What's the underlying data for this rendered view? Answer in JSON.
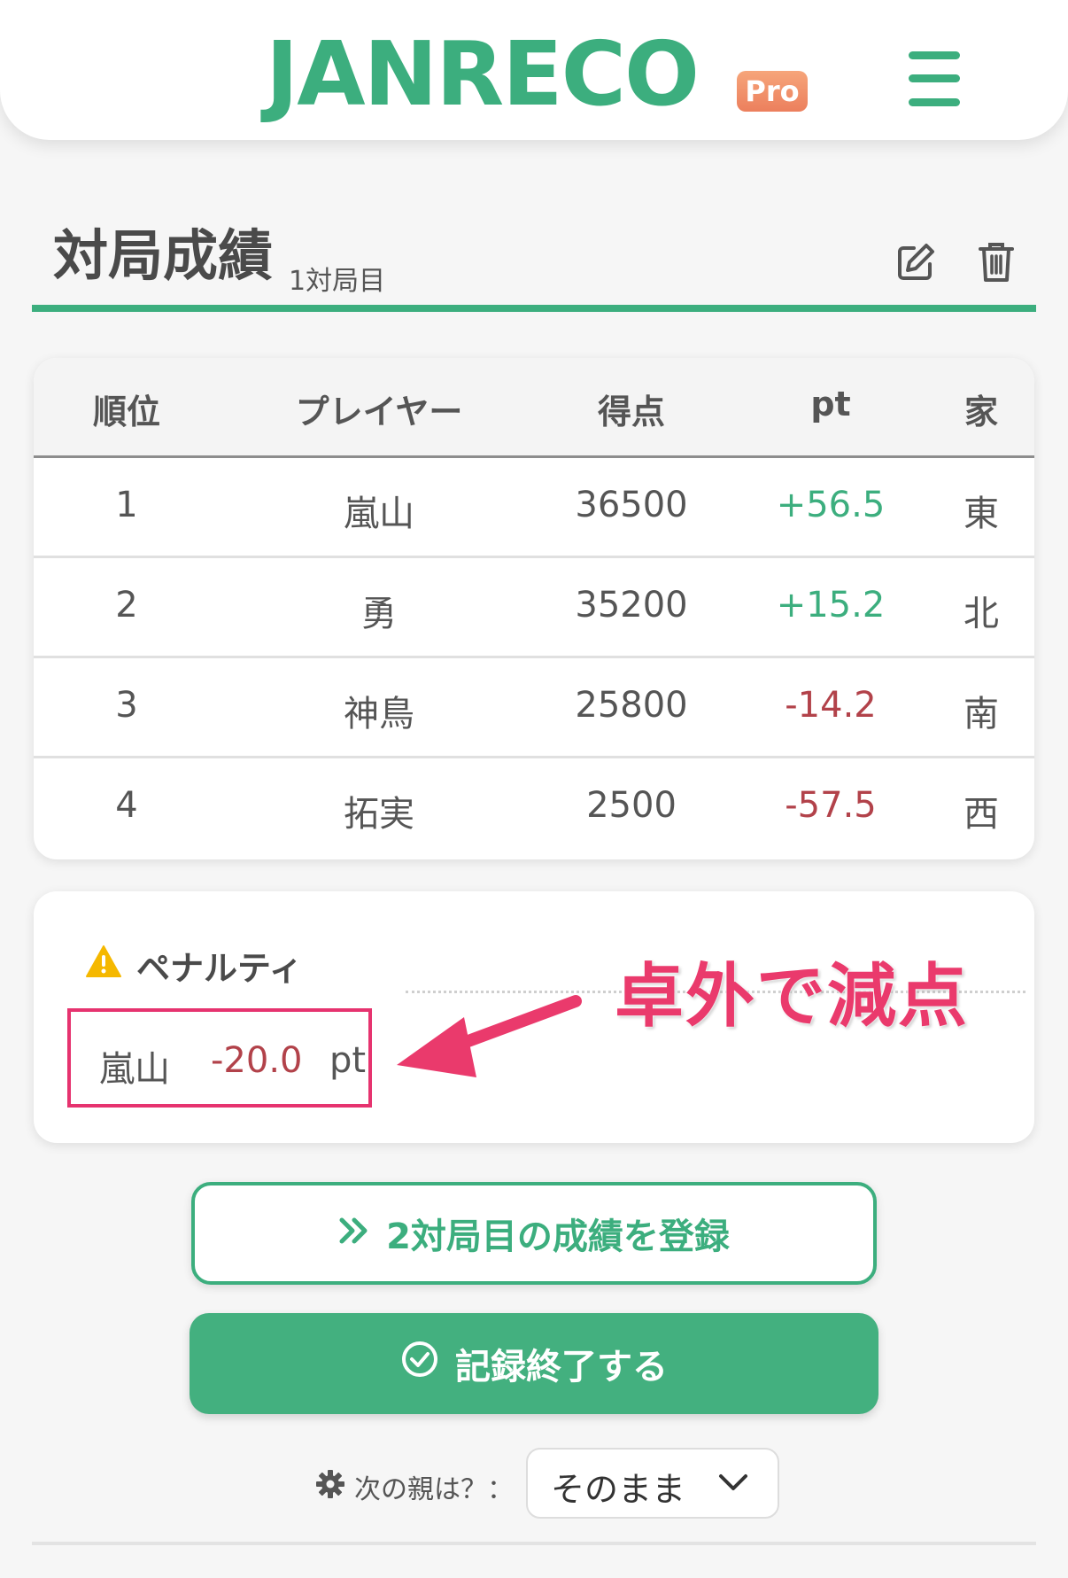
{
  "header": {
    "logo": "JANRECO",
    "badge": "Pro"
  },
  "section": {
    "title": "対局成績",
    "subtitle": "1対局目"
  },
  "table": {
    "headers": [
      "順位",
      "プレイヤー",
      "得点",
      "pt",
      "家"
    ],
    "rows": [
      {
        "rank": "1",
        "player": "嵐山",
        "score": "36500",
        "pt": "+56.5",
        "seat": "東"
      },
      {
        "rank": "2",
        "player": "勇",
        "score": "35200",
        "pt": "+15.2",
        "seat": "北"
      },
      {
        "rank": "3",
        "player": "神鳥",
        "score": "25800",
        "pt": "-14.2",
        "seat": "南"
      },
      {
        "rank": "4",
        "player": "拓実",
        "score": "2500",
        "pt": "-57.5",
        "seat": "西"
      }
    ]
  },
  "penalty": {
    "heading": "ペナルティ",
    "player": "嵐山",
    "value": "-20.0",
    "unit": "pt"
  },
  "annotation": "卓外で減点",
  "buttons": {
    "next_game": "2対局目の成績を登録",
    "finish": "記録終了する"
  },
  "next_dealer": {
    "label": "次の親は？：",
    "selected": "そのまま"
  },
  "colors": {
    "brand": "#3cae7e",
    "negative": "#b2424a",
    "annotation": "#ea3a6c",
    "badge": "#ec7f5d"
  }
}
